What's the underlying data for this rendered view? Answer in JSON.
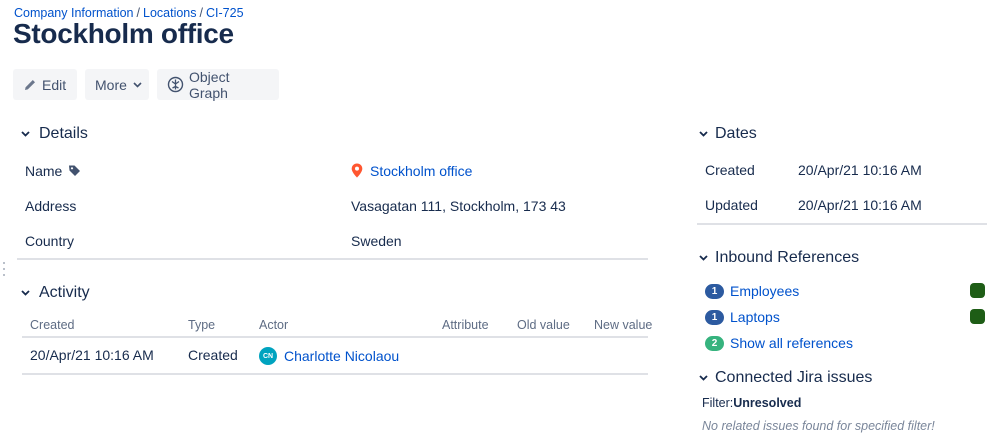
{
  "breadcrumb": {
    "items": [
      "Company Information",
      "Locations",
      "CI-725"
    ],
    "separator": "/"
  },
  "page_title": "Stockholm office",
  "toolbar": {
    "edit_label": "Edit",
    "more_label": "More",
    "object_graph_label": "Object Graph"
  },
  "details": {
    "heading": "Details",
    "rows": [
      {
        "label": "Name",
        "value": "Stockholm office"
      },
      {
        "label": "Address",
        "value": "Vasagatan 111, Stockholm, 173 43"
      },
      {
        "label": "Country",
        "value": "Sweden"
      }
    ]
  },
  "activity": {
    "heading": "Activity",
    "columns": [
      "Created",
      "Type",
      "Actor",
      "Attribute",
      "Old value",
      "New value"
    ],
    "rows": [
      {
        "created": "20/Apr/21 10:16 AM",
        "type": "Created",
        "actor_initials": "CN",
        "actor": "Charlotte Nicolaou",
        "attribute": "",
        "old_value": "",
        "new_value": ""
      }
    ]
  },
  "dates": {
    "heading": "Dates",
    "rows": [
      {
        "label": "Created",
        "value": "20/Apr/21 10:16 AM"
      },
      {
        "label": "Updated",
        "value": "20/Apr/21 10:16 AM"
      }
    ]
  },
  "inbound_references": {
    "heading": "Inbound References",
    "items": [
      {
        "count": "1",
        "label": "Employees",
        "status_color": "#1e5d16"
      },
      {
        "count": "1",
        "label": "Laptops",
        "status_color": "#1e5d16"
      }
    ],
    "show_all": {
      "count": "2",
      "label": "Show all references"
    }
  },
  "jira": {
    "heading": "Connected Jira issues",
    "filter_label": "Filter:",
    "filter_value": "Unresolved",
    "empty_message": "No related issues found for specified filter!"
  },
  "colors": {
    "link": "#0052cc",
    "text": "#172b4d",
    "location_pin": "#ff5630",
    "avatar": "#00a3bf",
    "pill_blue": "#2c5aa0",
    "pill_green": "#36b37e"
  }
}
